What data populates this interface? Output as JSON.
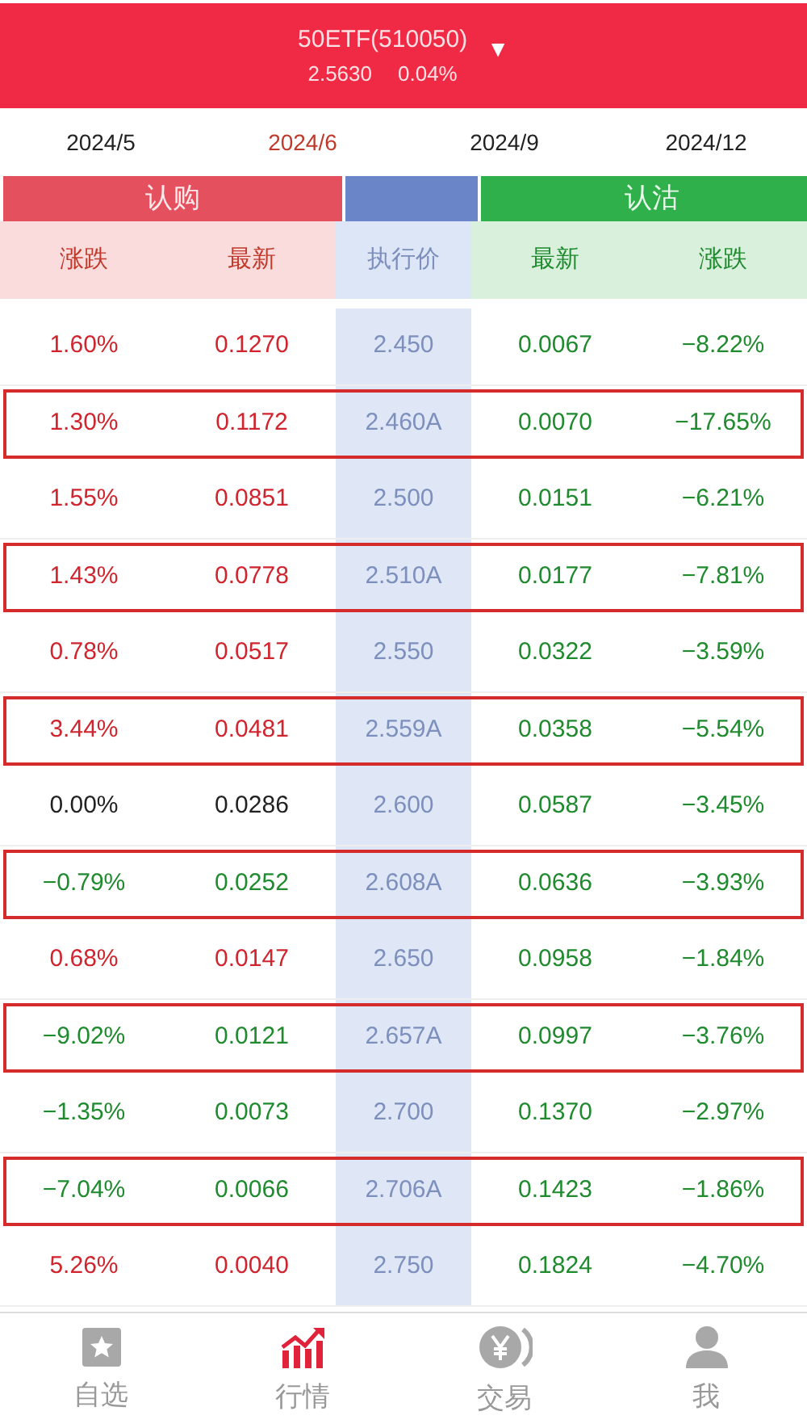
{
  "header": {
    "title": "50ETF(510050)",
    "price": "2.5630",
    "change": "0.04%",
    "dropdown": "▼"
  },
  "expiries": [
    {
      "label": "2024/5",
      "selected": false
    },
    {
      "label": "2024/6",
      "selected": true
    },
    {
      "label": "2024/9",
      "selected": false
    },
    {
      "label": "2024/12",
      "selected": false
    }
  ],
  "groups": {
    "call": "认购",
    "put": "认沽"
  },
  "columns": [
    "涨跌",
    "最新",
    "执行价",
    "最新",
    "涨跌"
  ],
  "rows": [
    {
      "highlighted": false,
      "cells": [
        {
          "text": "1.60%",
          "color": "#d0242e"
        },
        {
          "text": "0.1270",
          "color": "#d0242e"
        },
        {
          "text": "2.450",
          "color": "#7d8fbd"
        },
        {
          "text": "0.0067",
          "color": "#1f8a2e"
        },
        {
          "text": "−8.22%",
          "color": "#1f8a2e"
        }
      ]
    },
    {
      "highlighted": true,
      "cells": [
        {
          "text": "1.30%",
          "color": "#d0242e"
        },
        {
          "text": "0.1172",
          "color": "#d0242e"
        },
        {
          "text": "2.460A",
          "color": "#7d8fbd"
        },
        {
          "text": "0.0070",
          "color": "#1f8a2e"
        },
        {
          "text": "−17.65%",
          "color": "#1f8a2e"
        }
      ]
    },
    {
      "highlighted": false,
      "cells": [
        {
          "text": "1.55%",
          "color": "#d0242e"
        },
        {
          "text": "0.0851",
          "color": "#d0242e"
        },
        {
          "text": "2.500",
          "color": "#7d8fbd"
        },
        {
          "text": "0.0151",
          "color": "#1f8a2e"
        },
        {
          "text": "−6.21%",
          "color": "#1f8a2e"
        }
      ]
    },
    {
      "highlighted": true,
      "cells": [
        {
          "text": "1.43%",
          "color": "#d0242e"
        },
        {
          "text": "0.0778",
          "color": "#d0242e"
        },
        {
          "text": "2.510A",
          "color": "#7d8fbd"
        },
        {
          "text": "0.0177",
          "color": "#1f8a2e"
        },
        {
          "text": "−7.81%",
          "color": "#1f8a2e"
        }
      ]
    },
    {
      "highlighted": false,
      "cells": [
        {
          "text": "0.78%",
          "color": "#d0242e"
        },
        {
          "text": "0.0517",
          "color": "#d0242e"
        },
        {
          "text": "2.550",
          "color": "#7d8fbd"
        },
        {
          "text": "0.0322",
          "color": "#1f8a2e"
        },
        {
          "text": "−3.59%",
          "color": "#1f8a2e"
        }
      ]
    },
    {
      "highlighted": true,
      "cells": [
        {
          "text": "3.44%",
          "color": "#d0242e"
        },
        {
          "text": "0.0481",
          "color": "#d0242e"
        },
        {
          "text": "2.559A",
          "color": "#7d8fbd"
        },
        {
          "text": "0.0358",
          "color": "#1f8a2e"
        },
        {
          "text": "−5.54%",
          "color": "#1f8a2e"
        }
      ]
    },
    {
      "highlighted": false,
      "cells": [
        {
          "text": "0.00%",
          "color": "#222222"
        },
        {
          "text": "0.0286",
          "color": "#222222"
        },
        {
          "text": "2.600",
          "color": "#7d8fbd"
        },
        {
          "text": "0.0587",
          "color": "#1f8a2e"
        },
        {
          "text": "−3.45%",
          "color": "#1f8a2e"
        }
      ]
    },
    {
      "highlighted": true,
      "cells": [
        {
          "text": "−0.79%",
          "color": "#1f8a2e"
        },
        {
          "text": "0.0252",
          "color": "#1f8a2e"
        },
        {
          "text": "2.608A",
          "color": "#7d8fbd"
        },
        {
          "text": "0.0636",
          "color": "#1f8a2e"
        },
        {
          "text": "−3.93%",
          "color": "#1f8a2e"
        }
      ]
    },
    {
      "highlighted": false,
      "cells": [
        {
          "text": "0.68%",
          "color": "#d0242e"
        },
        {
          "text": "0.0147",
          "color": "#d0242e"
        },
        {
          "text": "2.650",
          "color": "#7d8fbd"
        },
        {
          "text": "0.0958",
          "color": "#1f8a2e"
        },
        {
          "text": "−1.84%",
          "color": "#1f8a2e"
        }
      ]
    },
    {
      "highlighted": true,
      "cells": [
        {
          "text": "−9.02%",
          "color": "#1f8a2e"
        },
        {
          "text": "0.0121",
          "color": "#1f8a2e"
        },
        {
          "text": "2.657A",
          "color": "#7d8fbd"
        },
        {
          "text": "0.0997",
          "color": "#1f8a2e"
        },
        {
          "text": "−3.76%",
          "color": "#1f8a2e"
        }
      ]
    },
    {
      "highlighted": false,
      "cells": [
        {
          "text": "−1.35%",
          "color": "#1f8a2e"
        },
        {
          "text": "0.0073",
          "color": "#1f8a2e"
        },
        {
          "text": "2.700",
          "color": "#7d8fbd"
        },
        {
          "text": "0.1370",
          "color": "#1f8a2e"
        },
        {
          "text": "−2.97%",
          "color": "#1f8a2e"
        }
      ]
    },
    {
      "highlighted": true,
      "cells": [
        {
          "text": "−7.04%",
          "color": "#1f8a2e"
        },
        {
          "text": "0.0066",
          "color": "#1f8a2e"
        },
        {
          "text": "2.706A",
          "color": "#7d8fbd"
        },
        {
          "text": "0.1423",
          "color": "#1f8a2e"
        },
        {
          "text": "−1.86%",
          "color": "#1f8a2e"
        }
      ]
    },
    {
      "highlighted": false,
      "cells": [
        {
          "text": "5.26%",
          "color": "#d0242e"
        },
        {
          "text": "0.0040",
          "color": "#d0242e"
        },
        {
          "text": "2.750",
          "color": "#7d8fbd"
        },
        {
          "text": "0.1824",
          "color": "#1f8a2e"
        },
        {
          "text": "−4.70%",
          "color": "#1f8a2e"
        }
      ]
    }
  ],
  "nav": [
    {
      "label": "自选",
      "selected": false
    },
    {
      "label": "行情",
      "selected": true
    },
    {
      "label": "交易",
      "selected": false
    },
    {
      "label": "我",
      "selected": false
    }
  ]
}
